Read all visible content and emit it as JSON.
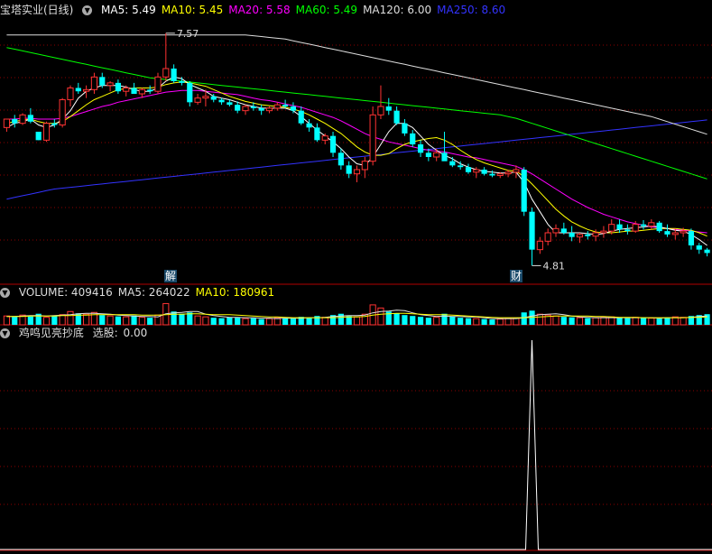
{
  "title": "宝塔实业(日线)",
  "colors": {
    "up": "#ff3333",
    "down": "#00ffff",
    "ma5": "#ffffff",
    "ma10": "#ffff00",
    "ma20": "#ff00ff",
    "ma60": "#00ff00",
    "ma120": "#dddddd",
    "ma250": "#3333ff",
    "grid": "#8b0000",
    "bg": "#000000"
  },
  "main_legend": [
    {
      "label": "MA5:",
      "value": "5.49",
      "color": "#ffffff"
    },
    {
      "label": "MA10:",
      "value": "5.45",
      "color": "#ffff00"
    },
    {
      "label": "MA20:",
      "value": "5.58",
      "color": "#ff00ff"
    },
    {
      "label": "MA60:",
      "value": "5.49",
      "color": "#00ff00"
    },
    {
      "label": "MA120:",
      "value": "6.00",
      "color": "#dddddd"
    },
    {
      "label": "MA250:",
      "value": "8.60",
      "color": "#3333ff"
    }
  ],
  "volume_legend": [
    {
      "label": "VOLUME:",
      "value": "409416",
      "color": "#dddddd"
    },
    {
      "label": "MA5:",
      "value": "264022",
      "color": "#dddddd"
    },
    {
      "label": "MA10:",
      "value": "180961",
      "color": "#ffff00"
    }
  ],
  "indicator_legend": {
    "name": "鸡鸣见亮抄底",
    "label": "选股:",
    "value": "0.00"
  },
  "annotations": {
    "high": "7.57",
    "low": "4.81",
    "jie": "解",
    "cai": "财"
  },
  "chart_data": {
    "type": "candlestick",
    "title": "宝塔实业(日线)",
    "price_range": [
      4.6,
      7.75
    ],
    "high_label": 7.57,
    "low_label": 4.81,
    "candles": [
      [
        6.45,
        6.55,
        6.4,
        6.55
      ],
      [
        6.55,
        6.6,
        6.45,
        6.5
      ],
      [
        6.5,
        6.62,
        6.48,
        6.6
      ],
      [
        6.6,
        6.68,
        6.5,
        6.52
      ],
      [
        6.4,
        6.4,
        6.3,
        6.3
      ],
      [
        6.3,
        6.52,
        6.28,
        6.5
      ],
      [
        6.5,
        6.55,
        6.45,
        6.48
      ],
      [
        6.48,
        6.8,
        6.45,
        6.78
      ],
      [
        6.78,
        6.95,
        6.7,
        6.92
      ],
      [
        6.92,
        6.98,
        6.85,
        6.88
      ],
      [
        6.88,
        6.95,
        6.8,
        6.9
      ],
      [
        6.9,
        7.1,
        6.85,
        7.05
      ],
      [
        7.05,
        7.1,
        6.92,
        6.95
      ],
      [
        6.95,
        7.0,
        6.88,
        6.98
      ],
      [
        6.98,
        7.02,
        6.85,
        6.88
      ],
      [
        6.88,
        6.95,
        6.82,
        6.92
      ],
      [
        6.92,
        6.98,
        6.85,
        6.85
      ],
      [
        6.85,
        6.92,
        6.8,
        6.9
      ],
      [
        6.9,
        6.95,
        6.85,
        6.88
      ],
      [
        6.88,
        7.1,
        6.85,
        7.05
      ],
      [
        7.05,
        7.57,
        7.0,
        7.15
      ],
      [
        7.15,
        7.2,
        6.98,
        7.0
      ],
      [
        7.0,
        7.05,
        6.95,
        6.98
      ],
      [
        6.98,
        7.0,
        6.7,
        6.75
      ],
      [
        6.75,
        6.85,
        6.72,
        6.8
      ],
      [
        6.8,
        6.9,
        6.7,
        6.82
      ],
      [
        6.82,
        6.85,
        6.75,
        6.78
      ],
      [
        6.78,
        6.8,
        6.72,
        6.75
      ],
      [
        6.75,
        6.78,
        6.7,
        6.72
      ],
      [
        6.72,
        6.76,
        6.62,
        6.65
      ],
      [
        6.65,
        6.72,
        6.6,
        6.7
      ],
      [
        6.7,
        6.75,
        6.65,
        6.68
      ],
      [
        6.68,
        6.72,
        6.6,
        6.65
      ],
      [
        6.65,
        6.7,
        6.62,
        6.68
      ],
      [
        6.68,
        6.75,
        6.65,
        6.72
      ],
      [
        6.72,
        6.78,
        6.68,
        6.7
      ],
      [
        6.7,
        6.75,
        6.62,
        6.65
      ],
      [
        6.65,
        6.7,
        6.48,
        6.5
      ],
      [
        6.5,
        6.55,
        6.4,
        6.45
      ],
      [
        6.45,
        6.5,
        6.28,
        6.3
      ],
      [
        6.3,
        6.38,
        6.25,
        6.35
      ],
      [
        6.35,
        6.4,
        6.1,
        6.15
      ],
      [
        6.15,
        6.2,
        5.95,
        6.0
      ],
      [
        6.0,
        6.05,
        5.85,
        5.9
      ],
      [
        5.9,
        6.0,
        5.8,
        5.95
      ],
      [
        5.95,
        6.1,
        5.85,
        6.05
      ],
      [
        6.05,
        6.7,
        6.0,
        6.6
      ],
      [
        6.6,
        6.95,
        6.55,
        6.7
      ],
      [
        6.7,
        6.8,
        6.6,
        6.65
      ],
      [
        6.65,
        6.7,
        6.48,
        6.5
      ],
      [
        6.5,
        6.55,
        6.35,
        6.38
      ],
      [
        6.38,
        6.42,
        6.22,
        6.25
      ],
      [
        6.25,
        6.3,
        6.1,
        6.15
      ],
      [
        6.15,
        6.2,
        6.05,
        6.1
      ],
      [
        6.1,
        6.2,
        6.05,
        6.15
      ],
      [
        6.15,
        6.4,
        6.1,
        6.05
      ],
      [
        6.05,
        6.1,
        5.98,
        6.0
      ],
      [
        6.0,
        6.05,
        5.95,
        5.98
      ],
      [
        5.98,
        6.02,
        5.9,
        5.92
      ],
      [
        5.92,
        5.98,
        5.85,
        5.95
      ],
      [
        5.95,
        5.98,
        5.88,
        5.9
      ],
      [
        5.9,
        5.94,
        5.86,
        5.88
      ],
      [
        5.88,
        5.92,
        5.85,
        5.9
      ],
      [
        5.9,
        5.95,
        5.86,
        5.92
      ],
      [
        5.92,
        6.0,
        5.85,
        5.95
      ],
      [
        5.95,
        5.98,
        5.4,
        5.45
      ],
      [
        5.45,
        5.5,
        4.81,
        5.0
      ],
      [
        5.0,
        5.15,
        4.95,
        5.1
      ],
      [
        5.1,
        5.25,
        5.05,
        5.2
      ],
      [
        5.2,
        5.3,
        5.15,
        5.25
      ],
      [
        5.25,
        5.32,
        5.18,
        5.2
      ],
      [
        5.2,
        5.28,
        5.1,
        5.15
      ],
      [
        5.15,
        5.2,
        5.08,
        5.18
      ],
      [
        5.18,
        5.22,
        5.12,
        5.16
      ],
      [
        5.16,
        5.24,
        5.1,
        5.2
      ],
      [
        5.2,
        5.28,
        5.14,
        5.22
      ],
      [
        5.22,
        5.36,
        5.18,
        5.3
      ],
      [
        5.3,
        5.36,
        5.2,
        5.24
      ],
      [
        5.24,
        5.3,
        5.18,
        5.22
      ],
      [
        5.22,
        5.34,
        5.2,
        5.3
      ],
      [
        5.3,
        5.35,
        5.24,
        5.28
      ],
      [
        5.28,
        5.36,
        5.24,
        5.32
      ],
      [
        5.32,
        5.34,
        5.2,
        5.22
      ],
      [
        5.22,
        5.3,
        5.15,
        5.18
      ],
      [
        5.18,
        5.25,
        5.12,
        5.2
      ],
      [
        5.2,
        5.26,
        5.15,
        5.22
      ],
      [
        5.22,
        5.25,
        5.0,
        5.05
      ],
      [
        5.05,
        5.08,
        4.95,
        5.0
      ],
      [
        5.0,
        5.02,
        4.92,
        4.96
      ]
    ],
    "ma_series": {
      "ma5": [
        6.45,
        6.5,
        6.52,
        6.55,
        6.48,
        6.45,
        6.48,
        6.55,
        6.65,
        6.8,
        6.88,
        6.92,
        6.95,
        6.95,
        6.95,
        6.93,
        6.9,
        6.88,
        6.88,
        6.92,
        7.0,
        7.05,
        7.03,
        6.96,
        6.92,
        6.88,
        6.82,
        6.8,
        6.78,
        6.75,
        6.72,
        6.7,
        6.68,
        6.68,
        6.68,
        6.68,
        6.65,
        6.58,
        6.5,
        6.42,
        6.35,
        6.28,
        6.2,
        6.1,
        6.02,
        6.0,
        6.1,
        6.25,
        6.4,
        6.5,
        6.5,
        6.45,
        6.35,
        6.25,
        6.18,
        6.12,
        6.08,
        6.02,
        5.98,
        5.95,
        5.93,
        5.92,
        5.91,
        5.91,
        5.92,
        5.8,
        5.6,
        5.45,
        5.3,
        5.2,
        5.2,
        5.2,
        5.2,
        5.19,
        5.18,
        5.19,
        5.22,
        5.24,
        5.25,
        5.26,
        5.27,
        5.28,
        5.27,
        5.25,
        5.23,
        5.22,
        5.18,
        5.12,
        5.05
      ],
      "ma10": [
        6.5,
        6.52,
        6.54,
        6.55,
        6.52,
        6.5,
        6.5,
        6.52,
        6.58,
        6.65,
        6.72,
        6.78,
        6.82,
        6.86,
        6.9,
        6.91,
        6.92,
        6.92,
        6.92,
        6.93,
        6.96,
        6.98,
        6.99,
        6.98,
        6.96,
        6.94,
        6.9,
        6.86,
        6.82,
        6.79,
        6.76,
        6.74,
        6.72,
        6.71,
        6.7,
        6.69,
        6.67,
        6.64,
        6.6,
        6.55,
        6.5,
        6.44,
        6.38,
        6.3,
        6.22,
        6.16,
        6.12,
        6.12,
        6.14,
        6.2,
        6.25,
        6.28,
        6.3,
        6.32,
        6.33,
        6.3,
        6.25,
        6.18,
        6.12,
        6.07,
        6.03,
        6.0,
        5.97,
        5.94,
        5.93,
        5.87,
        5.78,
        5.68,
        5.58,
        5.48,
        5.4,
        5.33,
        5.28,
        5.24,
        5.21,
        5.2,
        5.2,
        5.21,
        5.22,
        5.22,
        5.23,
        5.24,
        5.25,
        5.25,
        5.25,
        5.24,
        5.23,
        5.2,
        5.16
      ],
      "ma20": [
        6.55,
        6.55,
        6.56,
        6.56,
        6.55,
        6.55,
        6.55,
        6.56,
        6.58,
        6.61,
        6.64,
        6.67,
        6.7,
        6.72,
        6.75,
        6.77,
        6.79,
        6.81,
        6.83,
        6.85,
        6.87,
        6.88,
        6.89,
        6.89,
        6.89,
        6.88,
        6.87,
        6.86,
        6.85,
        6.84,
        6.82,
        6.8,
        6.78,
        6.77,
        6.75,
        6.73,
        6.71,
        6.69,
        6.66,
        6.63,
        6.6,
        6.57,
        6.53,
        6.48,
        6.43,
        6.38,
        6.34,
        6.31,
        6.28,
        6.26,
        6.24,
        6.22,
        6.2,
        6.18,
        6.17,
        6.16,
        6.14,
        6.12,
        6.1,
        6.09,
        6.07,
        6.05,
        6.03,
        6.01,
        5.99,
        5.95,
        5.9,
        5.84,
        5.78,
        5.72,
        5.66,
        5.6,
        5.55,
        5.5,
        5.46,
        5.42,
        5.39,
        5.36,
        5.33,
        5.31,
        5.29,
        5.27,
        5.26,
        5.25,
        5.24,
        5.23,
        5.22,
        5.21,
        5.2
      ],
      "ma60": [
        7.4,
        7.38,
        7.36,
        7.34,
        7.32,
        7.3,
        7.28,
        7.26,
        7.24,
        7.22,
        7.2,
        7.18,
        7.16,
        7.14,
        7.12,
        7.1,
        7.08,
        7.06,
        7.04,
        7.03,
        7.02,
        7.01,
        7.0,
        6.99,
        6.98,
        6.97,
        6.96,
        6.95,
        6.94,
        6.93,
        6.92,
        6.91,
        6.9,
        6.89,
        6.88,
        6.87,
        6.86,
        6.85,
        6.84,
        6.83,
        6.82,
        6.81,
        6.8,
        6.79,
        6.78,
        6.77,
        6.76,
        6.75,
        6.74,
        6.73,
        6.72,
        6.71,
        6.7,
        6.69,
        6.68,
        6.67,
        6.66,
        6.65,
        6.64,
        6.63,
        6.62,
        6.61,
        6.6,
        6.58,
        6.56,
        6.53,
        6.5,
        6.47,
        6.44,
        6.41,
        6.38,
        6.35,
        6.32,
        6.29,
        6.26,
        6.23,
        6.2,
        6.17,
        6.14,
        6.11,
        6.08,
        6.05,
        6.02,
        5.99,
        5.96,
        5.93,
        5.9,
        5.87,
        5.84
      ],
      "ma120": [
        7.55,
        7.55,
        7.55,
        7.55,
        7.55,
        7.55,
        7.55,
        7.55,
        7.55,
        7.55,
        7.55,
        7.55,
        7.55,
        7.55,
        7.55,
        7.55,
        7.55,
        7.55,
        7.55,
        7.55,
        7.55,
        7.55,
        7.55,
        7.55,
        7.55,
        7.55,
        7.55,
        7.55,
        7.55,
        7.55,
        7.55,
        7.54,
        7.53,
        7.52,
        7.51,
        7.5,
        7.48,
        7.46,
        7.44,
        7.42,
        7.4,
        7.38,
        7.36,
        7.34,
        7.32,
        7.3,
        7.28,
        7.26,
        7.24,
        7.22,
        7.2,
        7.18,
        7.16,
        7.14,
        7.12,
        7.1,
        7.08,
        7.06,
        7.04,
        7.02,
        7.0,
        6.98,
        6.96,
        6.94,
        6.92,
        6.9,
        6.88,
        6.86,
        6.84,
        6.82,
        6.8,
        6.78,
        6.76,
        6.74,
        6.72,
        6.7,
        6.68,
        6.66,
        6.64,
        6.62,
        6.6,
        6.58,
        6.55,
        6.52,
        6.49,
        6.46,
        6.43,
        6.4,
        6.37
      ],
      "ma250": [
        5.6,
        5.62,
        5.64,
        5.66,
        5.68,
        5.7,
        5.72,
        5.73,
        5.74,
        5.75,
        5.76,
        5.77,
        5.78,
        5.79,
        5.8,
        5.81,
        5.82,
        5.83,
        5.84,
        5.85,
        5.86,
        5.87,
        5.88,
        5.89,
        5.9,
        5.91,
        5.92,
        5.93,
        5.94,
        5.95,
        5.96,
        5.97,
        5.98,
        5.99,
        6.0,
        6.01,
        6.02,
        6.03,
        6.04,
        6.05,
        6.06,
        6.07,
        6.08,
        6.09,
        6.1,
        6.11,
        6.12,
        6.13,
        6.14,
        6.15,
        6.16,
        6.17,
        6.18,
        6.19,
        6.2,
        6.21,
        6.22,
        6.23,
        6.24,
        6.25,
        6.26,
        6.27,
        6.28,
        6.29,
        6.3,
        6.31,
        6.32,
        6.33,
        6.34,
        6.35,
        6.36,
        6.37,
        6.38,
        6.39,
        6.4,
        6.41,
        6.42,
        6.43,
        6.44,
        6.45,
        6.46,
        6.47,
        6.48,
        6.49,
        6.5,
        6.51,
        6.52,
        6.53,
        6.54
      ]
    },
    "volume": [
      20,
      18,
      22,
      19,
      25,
      17,
      21,
      23,
      30,
      26,
      24,
      28,
      22,
      20,
      19,
      18,
      21,
      17,
      16,
      22,
      48,
      30,
      25,
      28,
      20,
      18,
      16,
      15,
      17,
      16,
      14,
      15,
      13,
      14,
      16,
      15,
      14,
      18,
      16,
      20,
      17,
      22,
      25,
      20,
      18,
      24,
      45,
      38,
      30,
      26,
      22,
      20,
      18,
      16,
      17,
      25,
      19,
      16,
      15,
      14,
      13,
      12,
      13,
      14,
      15,
      28,
      32,
      24,
      22,
      20,
      18,
      17,
      16,
      15,
      16,
      17,
      18,
      16,
      15,
      17,
      16,
      15,
      14,
      16,
      18,
      17,
      20,
      22,
      24
    ],
    "volume_ma5": [
      19,
      19,
      20,
      21,
      21,
      20,
      21,
      22,
      23,
      25,
      26,
      26,
      25,
      24,
      22,
      21,
      20,
      19,
      19,
      18,
      25,
      27,
      28,
      30,
      30,
      24,
      21,
      19,
      17,
      17,
      16,
      16,
      15,
      15,
      14,
      15,
      15,
      15,
      16,
      16,
      17,
      19,
      20,
      21,
      21,
      22,
      27,
      30,
      31,
      33,
      32,
      27,
      23,
      21,
      19,
      20,
      19,
      19,
      18,
      18,
      16,
      14,
      14,
      14,
      14,
      16,
      20,
      23,
      24,
      25,
      23,
      20,
      18,
      17,
      16,
      16,
      16,
      16,
      16,
      16,
      16,
      16,
      15,
      16,
      16,
      16,
      17,
      19,
      20
    ],
    "volume_ma10": [
      19,
      19,
      19,
      20,
      20,
      20,
      20,
      21,
      21,
      22,
      22,
      23,
      23,
      23,
      23,
      23,
      23,
      22,
      22,
      22,
      23,
      24,
      24,
      25,
      25,
      24,
      23,
      23,
      23,
      22,
      21,
      20,
      19,
      18,
      18,
      17,
      16,
      16,
      16,
      16,
      16,
      16,
      17,
      18,
      18,
      19,
      22,
      24,
      25,
      26,
      26,
      25,
      24,
      23,
      23,
      23,
      22,
      21,
      20,
      19,
      18,
      17,
      16,
      16,
      16,
      16,
      17,
      18,
      19,
      20,
      20,
      20,
      20,
      20,
      19,
      19,
      18,
      17,
      17,
      17,
      16,
      16,
      16,
      16,
      16,
      16,
      17,
      17,
      18
    ],
    "signal": {
      "index": 66,
      "value": 1,
      "baseline": 0
    }
  }
}
